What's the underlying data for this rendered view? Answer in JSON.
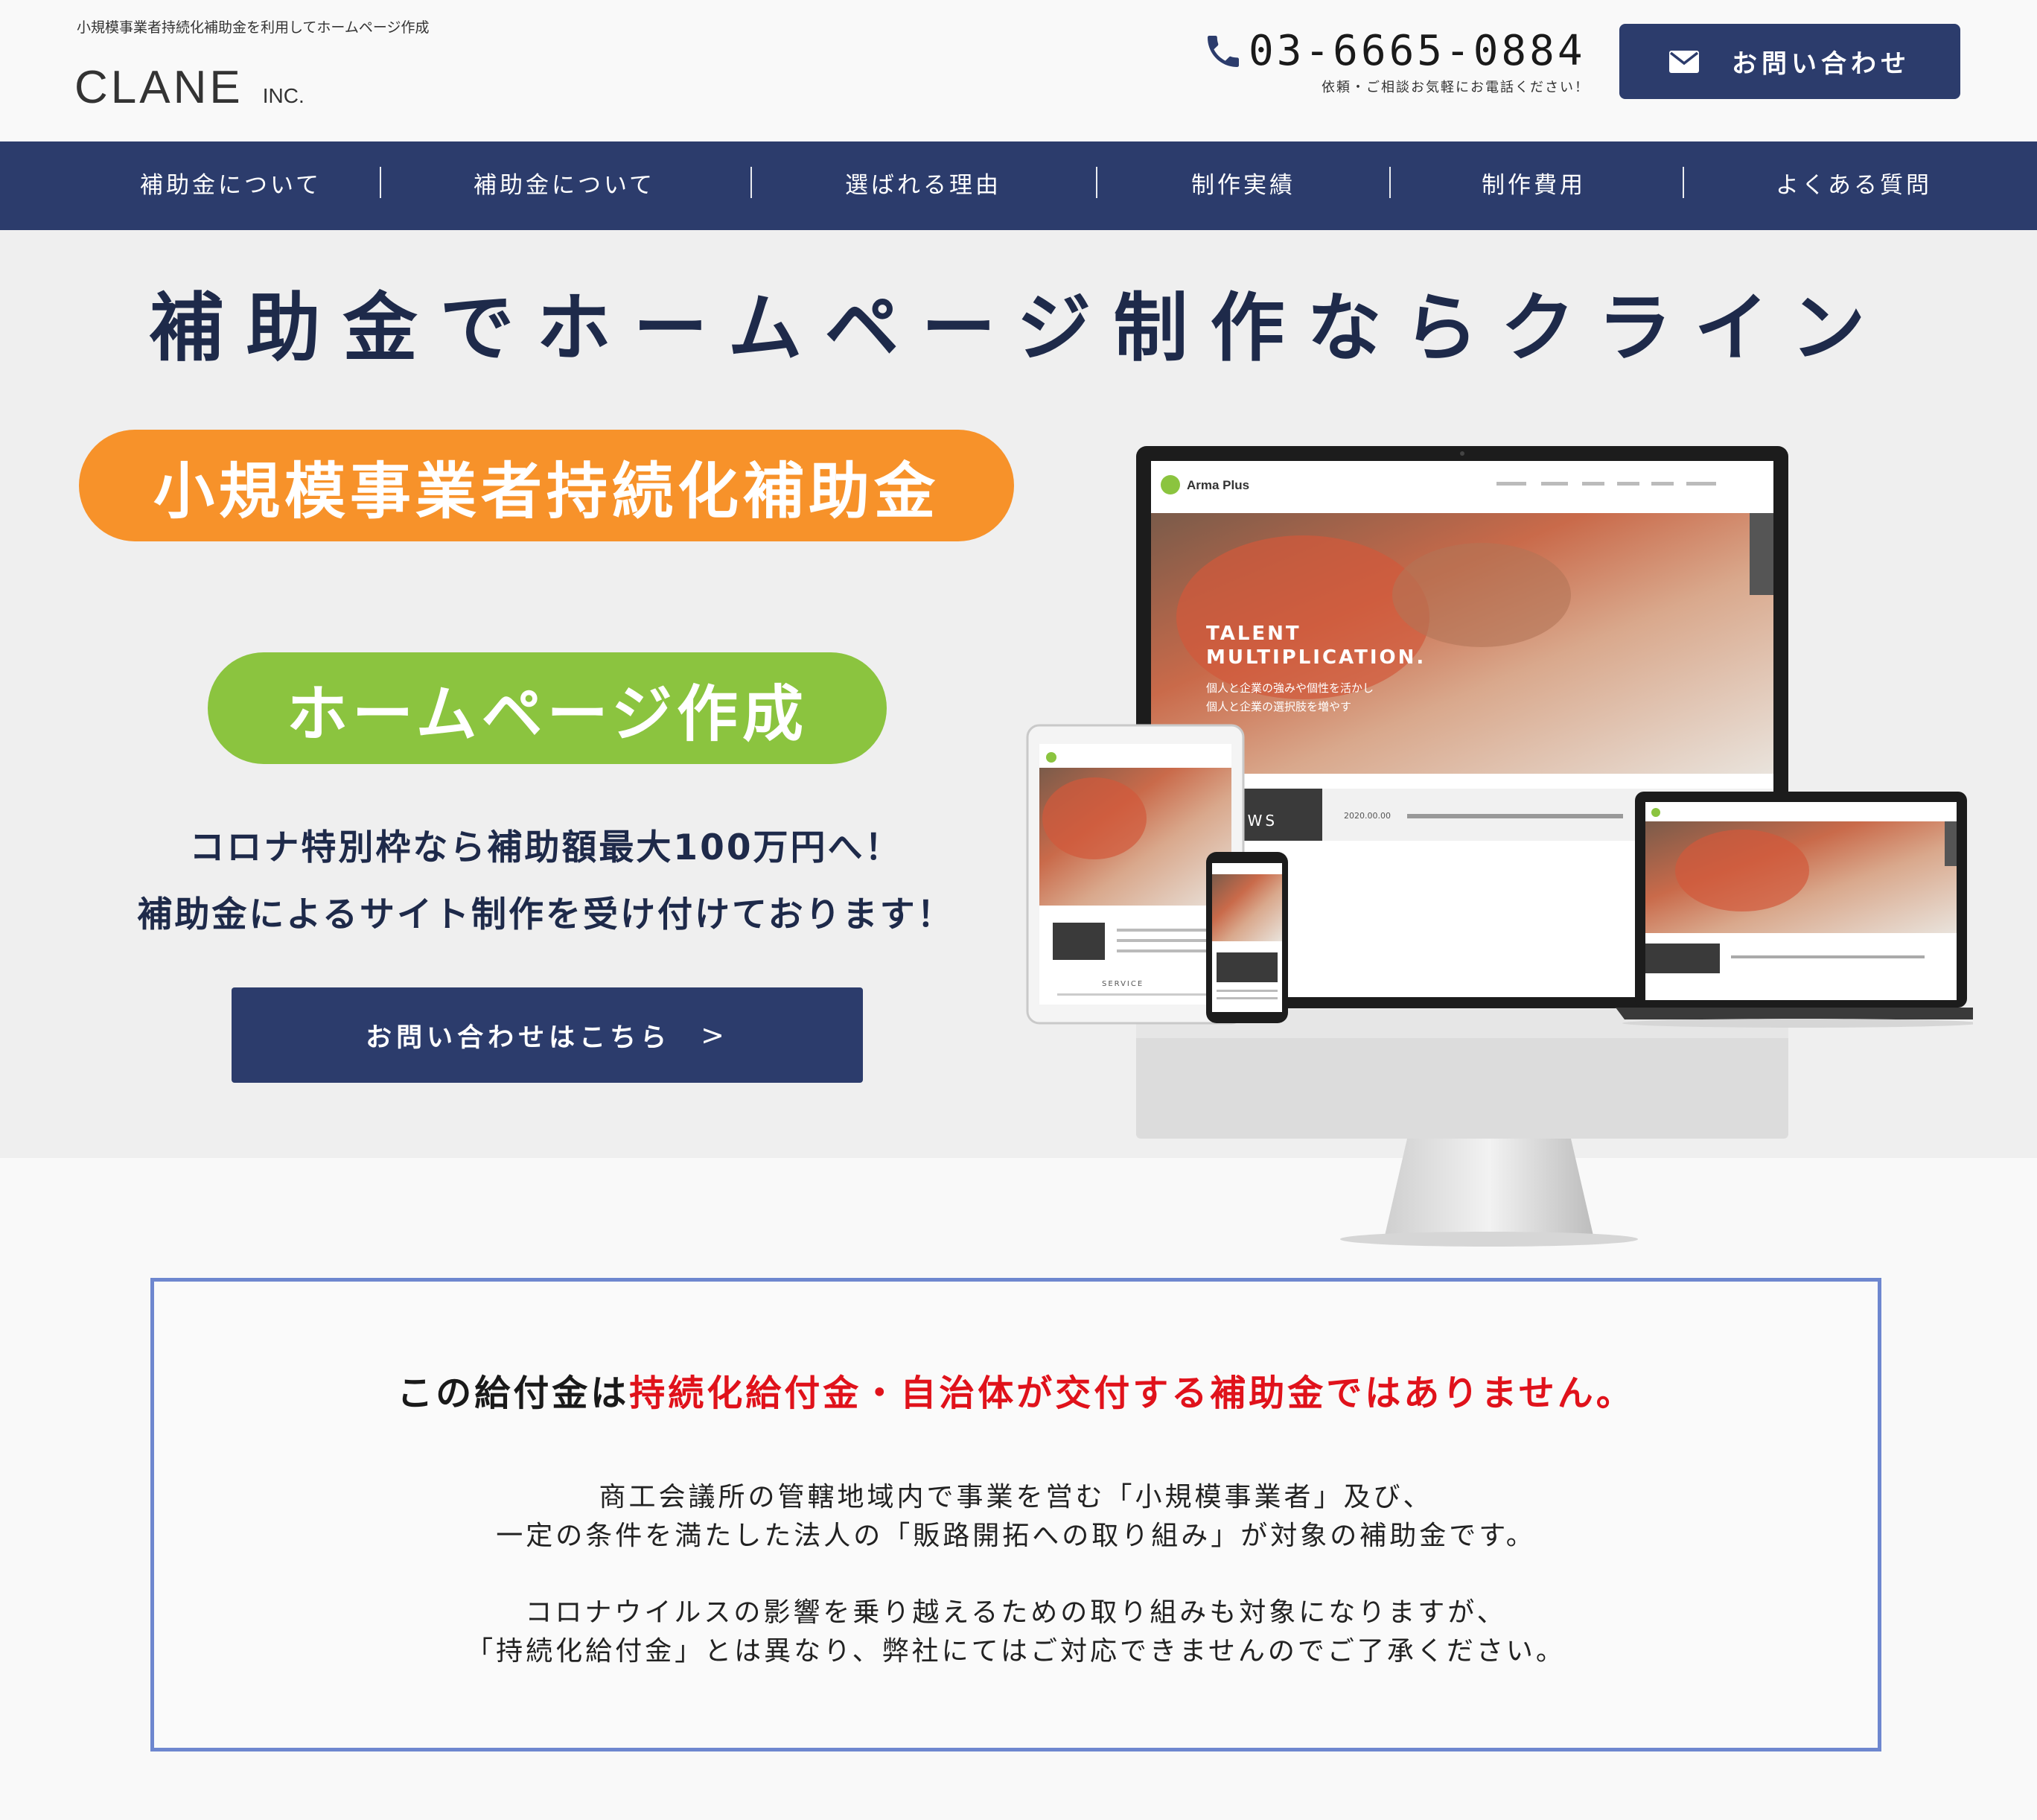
{
  "header": {
    "tagline": "小規模事業者持続化補助金を利用してホームページ作成",
    "logo_main": "CLANE",
    "logo_inc": "INC.",
    "phone_number": "03-6665-0884",
    "phone_note": "依頼・ご相談お気軽にお電話ください！",
    "contact_button_label": "お問い合わせ",
    "phone_icon": "phone-icon",
    "mail_icon": "mail-icon"
  },
  "nav": {
    "items": [
      {
        "label": "補助金について"
      },
      {
        "label": "補助金について"
      },
      {
        "label": "選ばれる理由"
      },
      {
        "label": "制作実績"
      },
      {
        "label": "制作費用"
      },
      {
        "label": "よくある質問"
      }
    ]
  },
  "hero": {
    "title": "補助金でホームページ制作ならクライン",
    "pill_orange": "小規模事業者持続化補助金",
    "pill_green": "ホームページ作成",
    "line1": "コロナ特別枠なら補助額最大100万円へ！",
    "line2": "補助金によるサイト制作を受け付けております！",
    "cta_label": "お問い合わせはこちら",
    "cta_arrow": ">",
    "mockup": {
      "brand": "Arma Plus",
      "headline_1": "TALENT",
      "headline_2": "MULTIPLICATION.",
      "sub_1": "個人と企業の強みや個性を活かし",
      "sub_2": "個人と企業の選択肢を増やす",
      "news_label": "NEWS",
      "news_date": "2020.00.00",
      "service_label": "SERVICE"
    }
  },
  "notice": {
    "heading_prefix": "この給付金は",
    "heading_red": "持続化給付金・自治体が交付する補助金ではありません。",
    "para1_line1": "商工会議所の管轄地域内で事業を営む「小規模事業者」及び、",
    "para1_line2": "一定の条件を満たした法人の「販路開拓への取り組み」が対象の補助金です。",
    "para2_line1": "コロナウイルスの影響を乗り越えるための取り組みも対象になりますが、",
    "para2_line2": "「持続化給付金」とは異なり、弊社にてはご対応できませんのでご了承ください。"
  },
  "colors": {
    "navy": "#2c3c6c",
    "orange": "#f7922a",
    "green": "#8bc43f",
    "red": "#e0121b",
    "notice_border": "#6e87cf",
    "hero_bg": "#efefef"
  }
}
